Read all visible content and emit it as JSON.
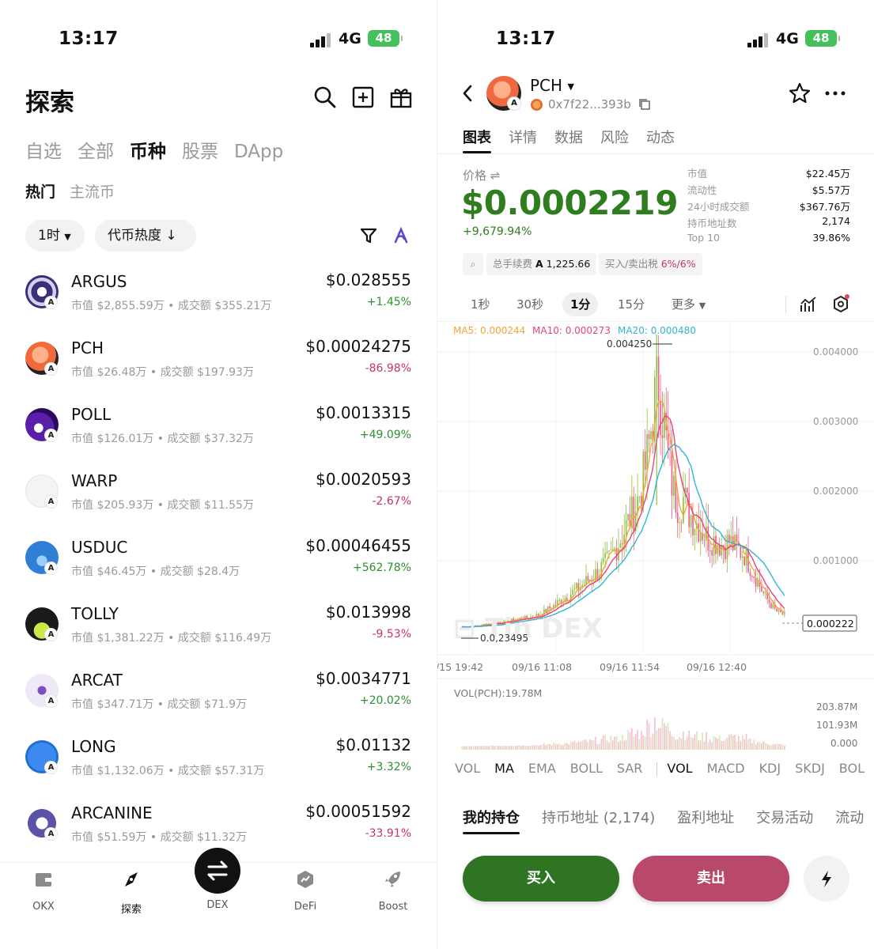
{
  "status": {
    "time": "13:17",
    "network": "4G",
    "battery": "48"
  },
  "explore": {
    "title": "探索",
    "icons": [
      "search-icon",
      "add-square-icon",
      "gift-icon"
    ],
    "category_tabs": [
      "自选",
      "全部",
      "币种",
      "股票",
      "DApp"
    ],
    "active_category": "币种",
    "sub_tabs": [
      "热门",
      "主流币"
    ],
    "active_sub_tab": "热门",
    "filter_interval": "1时",
    "filter_sort": "代币热度",
    "tokens": [
      {
        "name": "ARGUS",
        "market_cap": "市值 $2,855.59万",
        "volume": "成交额 $355.21万",
        "price": "$0.028555",
        "change": "+1.45%",
        "dir": "up",
        "color": "#3c2e78"
      },
      {
        "name": "PCH",
        "market_cap": "市值 $26.48万",
        "volume": "成交额 $197.93万",
        "price": "$0.00024275",
        "change": "-86.98%",
        "dir": "down",
        "color": "#ef6a3d"
      },
      {
        "name": "POLL",
        "market_cap": "市值 $126.01万",
        "volume": "成交额 $37.32万",
        "price": "$0.0013315",
        "change": "+49.09%",
        "dir": "up",
        "color": "#5a1fa8"
      },
      {
        "name": "WARP",
        "market_cap": "市值 $205.93万",
        "volume": "成交额 $11.55万",
        "price": "$0.0020593",
        "change": "-2.67%",
        "dir": "down",
        "color": "#f4f4f4"
      },
      {
        "name": "USDUC",
        "market_cap": "市值 $46.45万",
        "volume": "成交额 $28.4万",
        "price": "$0.00046455",
        "change": "+562.78%",
        "dir": "up",
        "color": "#2f7fd6"
      },
      {
        "name": "TOLLY",
        "market_cap": "市值 $1,381.22万",
        "volume": "成交额 $116.49万",
        "price": "$0.013998",
        "change": "-9.53%",
        "dir": "down",
        "color": "#1a1a1a"
      },
      {
        "name": "ARCAT",
        "market_cap": "市值 $347.71万",
        "volume": "成交额 $71.9万",
        "price": "$0.0034771",
        "change": "+20.02%",
        "dir": "up",
        "color": "#efe8f7"
      },
      {
        "name": "LONG",
        "market_cap": "市值 $1,132.06万",
        "volume": "成交额 $57.31万",
        "price": "$0.01132",
        "change": "+3.32%",
        "dir": "up",
        "color": "#1f6fd1"
      },
      {
        "name": "ARCANINE",
        "market_cap": "市值 $51.59万",
        "volume": "成交额 $11.32万",
        "price": "$0.00051592",
        "change": "-33.91%",
        "dir": "down",
        "color": "#5a54a8"
      }
    ],
    "nav": [
      {
        "label": "OKX",
        "icon": "wallet-icon"
      },
      {
        "label": "探索",
        "icon": "compass-icon"
      },
      {
        "label": "DEX",
        "icon": "swap-icon"
      },
      {
        "label": "DeFi",
        "icon": "defi-icon"
      },
      {
        "label": "Boost",
        "icon": "rocket-icon"
      }
    ]
  },
  "detail": {
    "symbol": "PCH",
    "address": "0x7f22...393b",
    "tabs": [
      "图表",
      "详情",
      "数据",
      "风险",
      "动态"
    ],
    "active_tab": "图表",
    "price_label": "价格",
    "price": "$0.0002219",
    "change": "+9,679.94%",
    "stats": [
      {
        "label": "市值",
        "value": "$22.45万"
      },
      {
        "label": "流动性",
        "value": "$5.57万"
      },
      {
        "label": "24小时成交额",
        "value": "$367.76万"
      },
      {
        "label": "持币地址数",
        "value": "2,174"
      },
      {
        "label": "Top 10",
        "value": "39.86%"
      }
    ],
    "fee_label": "总手续费",
    "fee_value": "1,225.66",
    "tax_label": "买入/卖出税",
    "tax_value": "6%/6%",
    "intervals": [
      "1秒",
      "30秒",
      "1分",
      "15分",
      "更多"
    ],
    "active_interval": "1分",
    "indicator_tabs": [
      "VOL",
      "MA",
      "EMA",
      "BOLL",
      "SAR",
      "VOL",
      "MACD",
      "KDJ",
      "SKDJ",
      "BOL"
    ],
    "holding_tabs": [
      "我的持仓",
      "持币地址 (2,174)",
      "盈利地址",
      "交易活动",
      "流动"
    ],
    "buy_label": "买入",
    "sell_label": "卖出"
  },
  "chart_data": {
    "type": "candlestick",
    "ma_labels": [
      {
        "text": "MA5: 0.000244",
        "color": "#f2a33a"
      },
      {
        "text": "MA10: 0.000273",
        "color": "#e2467a"
      },
      {
        "text": "MA20: 0.000480",
        "color": "#2fb6d8"
      }
    ],
    "y_ticks": [
      "0.004000",
      "0.003000",
      "0.002000",
      "0.001000"
    ],
    "y_tick_values": [
      0.004,
      0.003,
      0.002,
      0.001
    ],
    "x_ticks": [
      "/15 19:42",
      "09/16 11:08",
      "09/16 11:54",
      "09/16 12:40"
    ],
    "high_label": "0.004250",
    "low_label": "0.0,23495",
    "last_price_label": "0.000222",
    "ylim": [
      0.0,
      0.0045
    ],
    "vol_label": "VOL(PCH):19.78M",
    "vol_ticks": [
      "203.87M",
      "101.93M",
      "0.000"
    ],
    "close_samples": [
      5e-05,
      5e-05,
      6e-05,
      6e-05,
      8e-05,
      9e-05,
      0.0001,
      0.00012,
      0.00011,
      0.00013,
      0.00015,
      0.00016,
      0.00018,
      0.00017,
      0.0002,
      0.00022,
      0.00025,
      0.0003,
      0.00034,
      0.0004,
      0.00045,
      0.0005,
      0.00055,
      0.0006,
      0.00066,
      0.00072,
      0.00078,
      0.00084,
      0.00092,
      0.001,
      0.00112,
      0.00125,
      0.0014,
      0.00155,
      0.0017,
      0.0019,
      0.0022,
      0.0026,
      0.0032,
      0.0036,
      0.003,
      0.0024,
      0.002,
      0.0018,
      0.0019,
      0.0017,
      0.0016,
      0.0015,
      0.0014,
      0.0013,
      0.0013,
      0.00125,
      0.00122,
      0.00128,
      0.0012,
      0.00115,
      0.0011,
      0.00095,
      0.0008,
      0.00065,
      0.0005,
      0.0004,
      0.0003,
      0.00025,
      0.00022
    ]
  }
}
